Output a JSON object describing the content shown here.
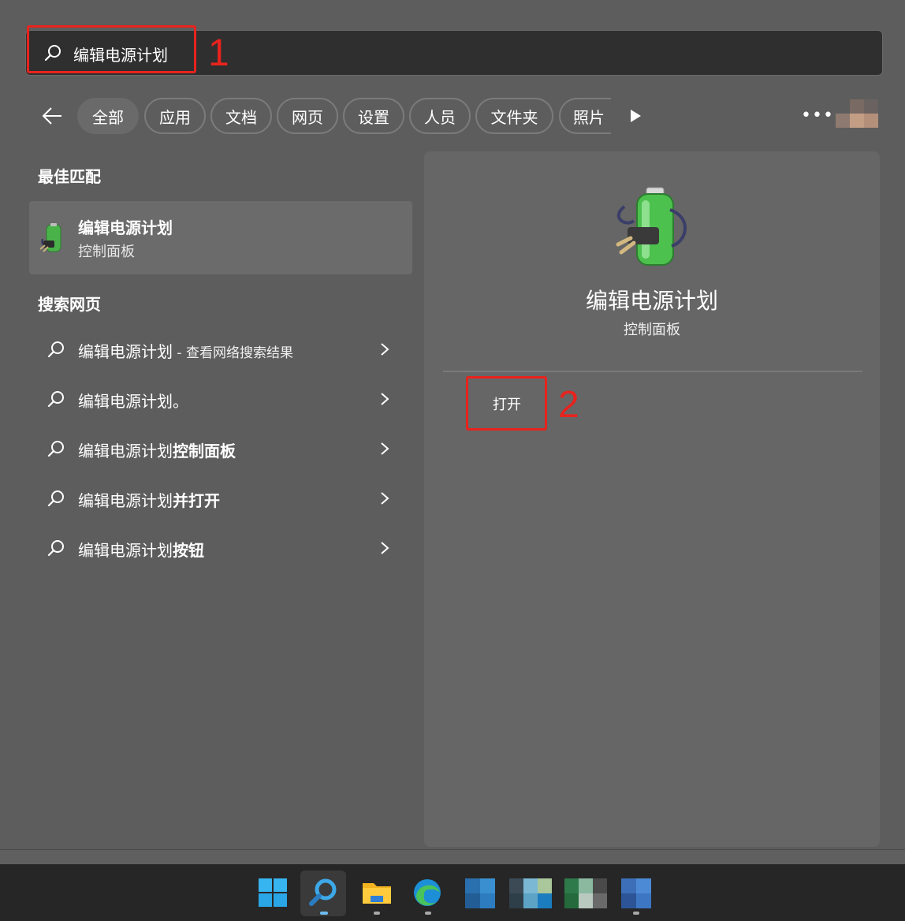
{
  "search": {
    "query": "编辑电源计划"
  },
  "annotations": {
    "step1": "1",
    "step2": "2",
    "color": "#e8231d"
  },
  "filters": {
    "back_icon": "arrow-left-icon",
    "chips": [
      "全部",
      "应用",
      "文档",
      "网页",
      "设置",
      "人员",
      "文件夹",
      "照片"
    ],
    "active": "全部",
    "more_label": "•••"
  },
  "best_match": {
    "heading": "最佳匹配",
    "title": "编辑电源计划",
    "subtitle": "控制面板",
    "icon": "power-plan-battery-icon"
  },
  "web_search": {
    "heading": "搜索网页",
    "items": [
      {
        "prefix": "编辑电源计划",
        "bold": "",
        "suffix": " - 查看网络搜索结果"
      },
      {
        "prefix": "编辑电源计划。",
        "bold": "",
        "suffix": ""
      },
      {
        "prefix": "编辑电源计划",
        "bold": "控制面板",
        "suffix": ""
      },
      {
        "prefix": "编辑电源计划",
        "bold": "并打开",
        "suffix": ""
      },
      {
        "prefix": "编辑电源计划",
        "bold": "按钮",
        "suffix": ""
      }
    ]
  },
  "detail": {
    "title": "编辑电源计划",
    "subtitle": "控制面板",
    "open_label": "打开"
  },
  "taskbar": {
    "icons": [
      "windows-start-icon",
      "search-icon",
      "file-explorer-icon",
      "edge-browser-icon",
      "app-icon",
      "app-icon",
      "app-icon",
      "app-icon"
    ]
  }
}
